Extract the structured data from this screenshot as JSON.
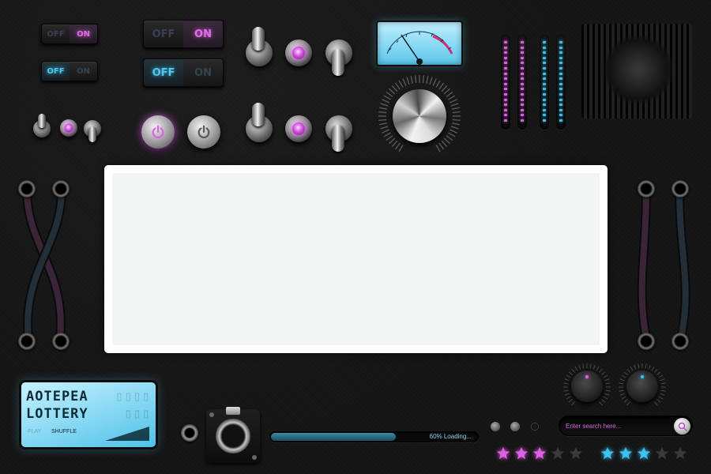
{
  "switches": {
    "small_pink": {
      "off": "OFF",
      "on": "ON"
    },
    "small_blue": {
      "off": "OFF",
      "on": "ON"
    },
    "large_pink": {
      "off": "OFF",
      "on": "ON"
    },
    "large_blue": {
      "off": "OFF",
      "on": "ON"
    }
  },
  "lcd": {
    "line1": "AOTEPEA",
    "line2": "LOTTERY",
    "label_play": "PLAY",
    "label_shuffle": "SHUFFLE"
  },
  "progress": {
    "value": 0.6,
    "label": "60% Loading..."
  },
  "search": {
    "placeholder": "Enter search here..."
  },
  "ratings": {
    "pink": {
      "value": 3,
      "max": 5
    },
    "blue": {
      "value": 3,
      "max": 5
    }
  },
  "colors": {
    "accent_pink": "#e05fe8",
    "accent_blue": "#3cc2f0",
    "background": "#141414",
    "panel": "#f3f4f4"
  },
  "icons": {
    "power": "power-icon",
    "search": "search-icon",
    "star": "star-icon"
  }
}
